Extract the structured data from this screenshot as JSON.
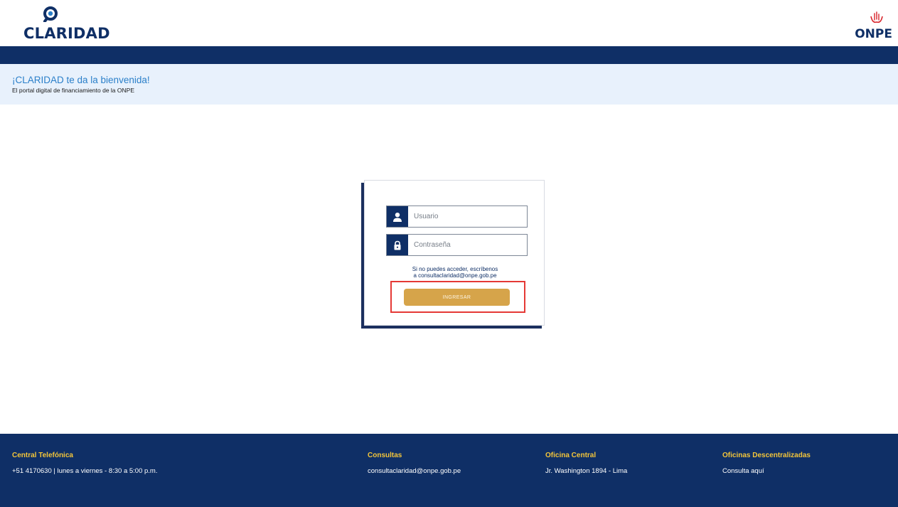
{
  "header": {
    "brand": "CLARIDAD",
    "partner": "ONPE"
  },
  "welcome": {
    "title": "¡CLARIDAD te da la bienvenida!",
    "subtitle": "El portal digital de financiamiento de la ONPE"
  },
  "login": {
    "user_placeholder": "Usuario",
    "user_icon": "user-icon",
    "password_placeholder": "Contraseña",
    "password_icon": "lock-icon",
    "help_line1": "Si no puedes acceder, escríbenos",
    "help_line2": "a consultaclaridad@onpe.gob.pe",
    "submit_label": "INGRESAR"
  },
  "footer": {
    "phone": {
      "heading": "Central Telefónica",
      "text": "+51 4170630 | lunes a viernes - 8:30 a 5:00 p.m."
    },
    "inquiries": {
      "heading": "Consultas",
      "text": "consultaclaridad@onpe.gob.pe"
    },
    "office": {
      "heading": "Oficina Central",
      "text": "Jr. Washington 1894 - Lima"
    },
    "regional": {
      "heading": "Oficinas Descentralizadas",
      "text": "Consulta aquí"
    }
  },
  "colors": {
    "navy": "#0f2f66",
    "accent_blue": "#2a7fc9",
    "welcome_bg": "#e8f1fc",
    "gold": "#d6a44a",
    "footer_heading": "#f3c53a",
    "onpe_red": "#d8232a",
    "highlight": "#e53935"
  }
}
